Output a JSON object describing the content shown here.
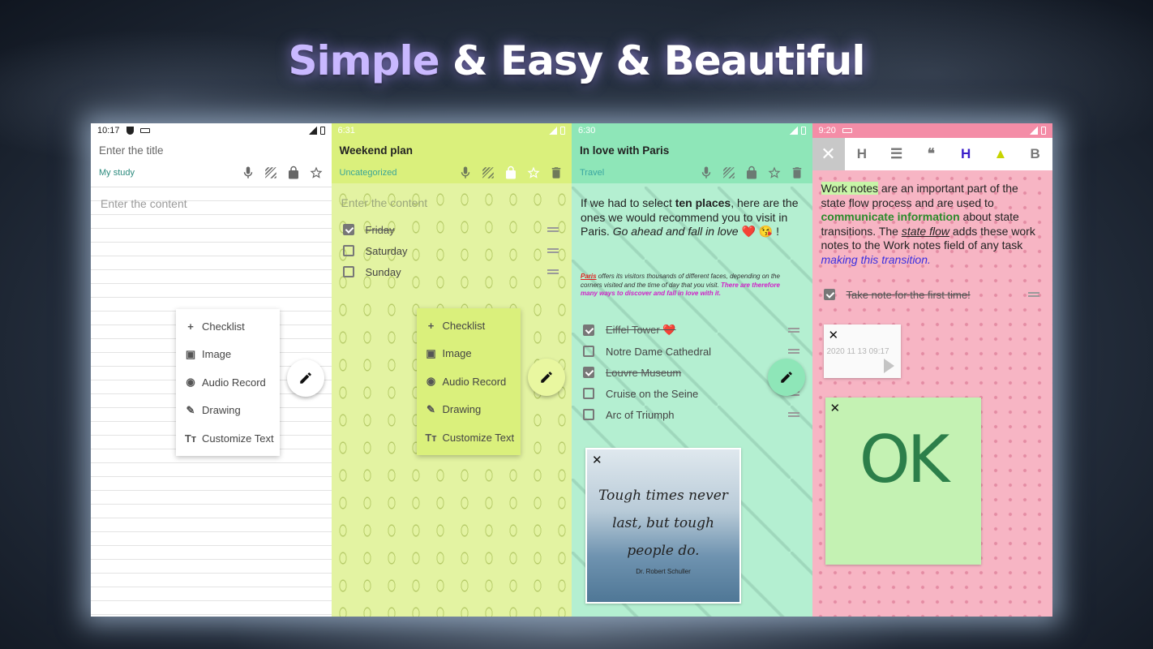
{
  "headline": {
    "part1": "Simple",
    "part2": " & Easy & Beautiful"
  },
  "phones": [
    {
      "time": "10:17",
      "title": "Enter the title",
      "category": "My study",
      "placeholder": "Enter the content",
      "menu": [
        "Checklist",
        "Image",
        "Audio Record",
        "Drawing",
        "Customize Text"
      ]
    },
    {
      "time": "6:31",
      "title": "Weekend plan",
      "category": "Uncategorized",
      "placeholder": "Enter the content",
      "checklist": [
        {
          "label": "Friday",
          "checked": true
        },
        {
          "label": "Saturday",
          "checked": false
        },
        {
          "label": "Sunday",
          "checked": false
        }
      ],
      "menu": [
        "Checklist",
        "Image",
        "Audio Record",
        "Drawing",
        "Customize Text"
      ]
    },
    {
      "time": "6:30",
      "title": "In love with Paris",
      "category": "Travel",
      "rich_text": {
        "a": "If we had to select ",
        "b": "ten places",
        "c": ", here are the ones we would recommend you to visit in Paris. ",
        "d": "Go ahead and fall in love",
        "e": " ❤️ 😘 !"
      },
      "small_note": {
        "a": "Paris",
        "b": " offers its visitors thousands of different faces, depending on the corners visited and the time of day that you visit. ",
        "c": "There are therefore many ways to discover and fall in love with it."
      },
      "checklist": [
        {
          "label": "Eiffel Tower ❤️",
          "checked": true
        },
        {
          "label": "Notre Dame Cathedral",
          "checked": false
        },
        {
          "label": "Louvre Museum",
          "checked": true
        },
        {
          "label": "Cruise on the Seine",
          "checked": false
        },
        {
          "label": "Arc of Triumph",
          "checked": false
        }
      ],
      "image_quote": {
        "line1": "Tough times never",
        "line2": "last, but tough",
        "line3": "people do.",
        "author": "Dr. Robert Schuller"
      }
    },
    {
      "time": "9:20",
      "toolbar": [
        "H",
        "☰",
        "❝",
        "H",
        "▲",
        "B"
      ],
      "rich_text": {
        "a": "Work notes",
        "b": " are an important part of the state flow process and are used to ",
        "c": "communicate information",
        "d": " about state transitions. The ",
        "e": "state flow",
        "f": " adds these work notes to the Work notes field of any task ",
        "g": "making this transition."
      },
      "check_item": {
        "label": "Take note for the first time!",
        "checked": true
      },
      "audio": {
        "timestamp": "2020 11 13 09:17"
      },
      "drawing_text": "OK"
    }
  ],
  "colors": {
    "phone2_bar": "#daf07c",
    "phone3_bar": "#8ee6b8",
    "phone4_bar": "#f48da7"
  }
}
